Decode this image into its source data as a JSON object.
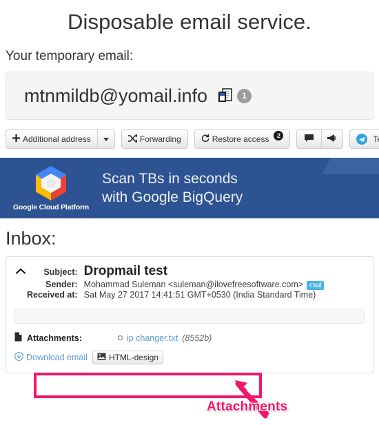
{
  "page": {
    "title": "Disposable email service.",
    "temp_email_label": "Your temporary email:",
    "inbox_label": "Inbox:"
  },
  "email_well": {
    "address": "mtnmildb@yomail.info",
    "copy_icon": "copy-documents-icon",
    "copy_badge": "1"
  },
  "toolbar": {
    "additional_address_label": "Additional address",
    "additional_address_icon": "plus-icon",
    "dropdown_icon": "caret-down-icon",
    "forwarding_label": "Forwarding",
    "forwarding_icon": "shuffle-icon",
    "restore_access_label": "Restore access",
    "restore_access_icon": "refresh-icon",
    "restore_access_badge": "2",
    "comment_icon": "speech-bubble-icon",
    "megaphone_icon": "megaphone-icon",
    "telegram_label": "Telegram",
    "telegram_icon": "telegram-icon"
  },
  "banner": {
    "logo_text": "Google Cloud Platform",
    "headline_line1": "Scan TBs in seconds",
    "headline_line2": "with Google BigQuery",
    "bg_color": "#2e5392",
    "corner_color": "#3b639f"
  },
  "mail": {
    "collapse_icon": "chevron-up-icon",
    "fields": [
      {
        "key": "Subject:",
        "value": "Dropmail test"
      },
      {
        "key": "Sender:",
        "value": "Mohammad Suleman <suleman@ilovefreesoftware.com>"
      },
      {
        "key": "Received at:",
        "value": "Sat May 27 2017 14:41:51 GMT+0530 (India Standard Time)"
      }
    ],
    "sender_chip": "<sul",
    "attachments": {
      "icon": "file-icon",
      "label": "Attachments:",
      "items": [
        {
          "name": "ip changer.txt",
          "size": "(8552b)"
        }
      ]
    },
    "actions": {
      "download_icon": "download-circle-icon",
      "download_label": "Download email",
      "html_design_icon": "image-icon",
      "html_design_label": "HTML-design"
    }
  },
  "annotation": {
    "label": "Attachments",
    "color": "#f2176a"
  }
}
